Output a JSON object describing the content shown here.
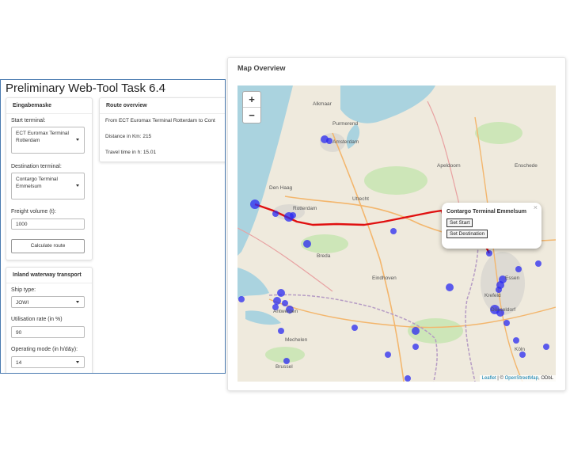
{
  "app": {
    "title": "Preliminary Web-Tool Task 6.4",
    "input_panel": {
      "header": "Eingabemaske",
      "start_label": "Start terminal:",
      "start_value": "ECT Euromax Terminal Rotterdam",
      "destination_label": "Destination terminal:",
      "destination_value": "Contargo Terminal Emmelsum",
      "freight_label": "Freight volume (t):",
      "freight_value": "1000",
      "calculate_label": "Calculate route"
    },
    "route_panel": {
      "header": "Route overview",
      "from_text": "From ECT Euromax Terminal Rotterdam to Cont",
      "distance_prefix": "Distance in Km: ",
      "distance_value": "215",
      "time_prefix": "Travel time in h: ",
      "time_value": "15.01"
    },
    "waterway_panel": {
      "header": "Inland waterway transport",
      "ship_label": "Ship type:",
      "ship_value": "JOWI",
      "util_label": "Utilisation rate (in %)",
      "util_value": "90",
      "mode_label": "Operating mode (in h/d&y):",
      "mode_value": "14"
    }
  },
  "map": {
    "title": "Map Overview",
    "zoom_in": "+",
    "zoom_out": "−",
    "popup": {
      "title": "Contargo Terminal Emmelsum",
      "close": "×",
      "set_start": "Set Start",
      "set_destination": "Set Destination"
    },
    "attribution_leaflet": "Leaflet",
    "attribution_sep": " | © ",
    "attribution_osm": "OpenStreetMap",
    "attribution_odbl": ", ODbL",
    "cities": [
      "Amsterdam",
      "Den Haag",
      "Rotterdam",
      "Antwerpen",
      "Brussel",
      "Essen",
      "Düsseldorf",
      "Köln",
      "Apeldoorn",
      "Alkmaar",
      "Purmerend",
      "Utrecht",
      "Breda",
      "Eindhoven",
      "Mechelen",
      "Krefeld",
      "Enschede"
    ],
    "route_color": "#e01010",
    "terminal_color": "#2a2af0"
  }
}
